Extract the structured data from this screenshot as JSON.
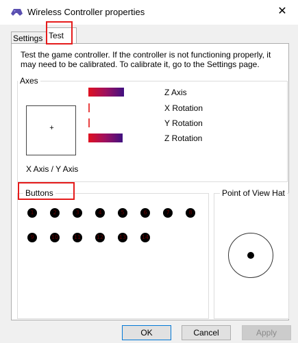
{
  "window": {
    "title": "Wireless Controller properties",
    "close_symbol": "✕",
    "icon": "game-controller-icon"
  },
  "tabs": [
    {
      "label": "Settings",
      "active": false
    },
    {
      "label": "Test",
      "active": true
    }
  ],
  "description": "Test the game controller.  If the controller is not functioning properly, it may need to be calibrated.  To calibrate it, go to the Settings page.",
  "axes": {
    "label": "Axes",
    "xy_label": "X Axis / Y Axis",
    "xy_marker": "+",
    "bars": [
      {
        "label": "Z Axis",
        "level": 0.5
      },
      {
        "label": "X Rotation",
        "level": 0.0
      },
      {
        "label": "Y Rotation",
        "level": 0.0
      },
      {
        "label": "Z Rotation",
        "level": 0.5
      }
    ]
  },
  "buttons": {
    "label": "Buttons",
    "items": [
      "1",
      "2",
      "3",
      "4",
      "5",
      "6",
      "7",
      "8",
      "9",
      "10",
      "11",
      "12",
      "13",
      "14"
    ]
  },
  "pov": {
    "label": "Point of View Hat"
  },
  "footer": {
    "ok": "OK",
    "cancel": "Cancel",
    "apply": "Apply"
  },
  "colors": {
    "highlight": "#e51a1a",
    "bar_start": "#e01020",
    "bar_end": "#401080",
    "button_text": "#6a0000"
  }
}
